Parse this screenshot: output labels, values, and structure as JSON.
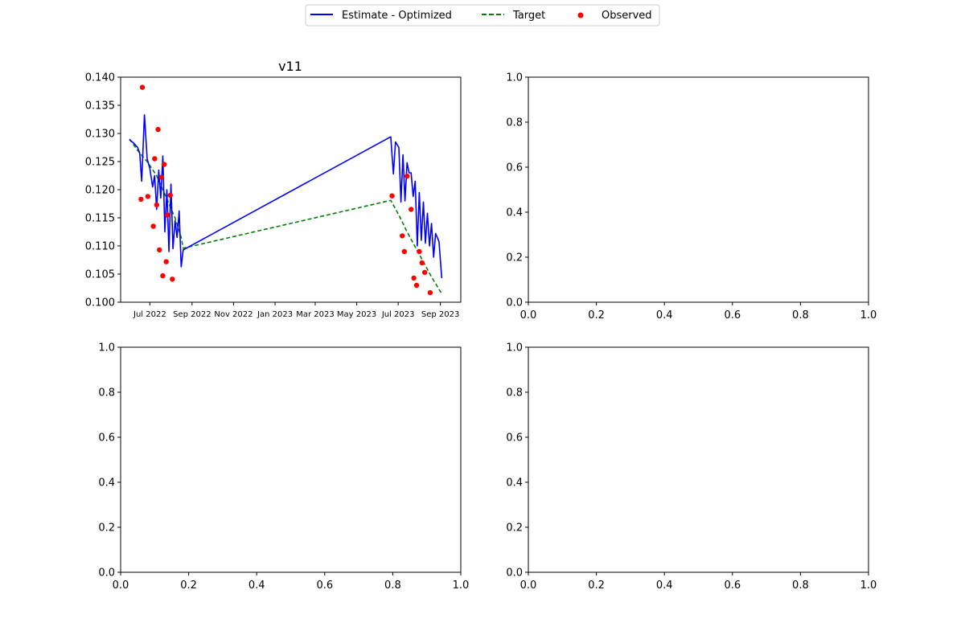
{
  "legend": {
    "placement": "top-center",
    "items": [
      {
        "label": "Estimate - Optimized",
        "color": "#0000ff",
        "style": "solid-line"
      },
      {
        "label": "Target",
        "color": "#008000",
        "style": "dashed-line"
      },
      {
        "label": "Observed",
        "color": "#ff0000",
        "style": "dot"
      }
    ]
  },
  "chart_data": [
    {
      "type": "line",
      "title": "v11",
      "xlabel": "",
      "ylabel": "",
      "x_axis": "date",
      "xlim": [
        "2022-05-19",
        "2023-10-01"
      ],
      "ylim": [
        0.1,
        0.14
      ],
      "xticks": [
        {
          "date": "2022-07-01",
          "label": "Jul 2022"
        },
        {
          "date": "2022-09-01",
          "label": "Sep 2022"
        },
        {
          "date": "2022-11-01",
          "label": "Nov 2022"
        },
        {
          "date": "2023-01-01",
          "label": "Jan 2023"
        },
        {
          "date": "2023-03-01",
          "label": "Mar 2023"
        },
        {
          "date": "2023-05-01",
          "label": "May 2023"
        },
        {
          "date": "2023-07-01",
          "label": "Jul 2023"
        },
        {
          "date": "2023-09-01",
          "label": "Sep 2023"
        }
      ],
      "yticks": [
        {
          "value": 0.1,
          "label": "0.100"
        },
        {
          "value": 0.105,
          "label": "0.105"
        },
        {
          "value": 0.11,
          "label": "0.110"
        },
        {
          "value": 0.115,
          "label": "0.115"
        },
        {
          "value": 0.12,
          "label": "0.120"
        },
        {
          "value": 0.125,
          "label": "0.125"
        },
        {
          "value": 0.13,
          "label": "0.130"
        },
        {
          "value": 0.135,
          "label": "0.135"
        },
        {
          "value": 0.14,
          "label": "0.140"
        }
      ],
      "series": [
        {
          "name": "Estimate - Optimized",
          "color": "#0000ff",
          "style": "solid",
          "points": [
            [
              "2022-06-01",
              0.1289
            ],
            [
              "2022-06-07",
              0.1283
            ],
            [
              "2022-06-13",
              0.1275
            ],
            [
              "2022-06-16",
              0.1265
            ],
            [
              "2022-06-19",
              0.1215
            ],
            [
              "2022-06-23",
              0.1333
            ],
            [
              "2022-06-27",
              0.1255
            ],
            [
              "2022-07-01",
              0.1237
            ],
            [
              "2022-07-05",
              0.1205
            ],
            [
              "2022-07-08",
              0.1225
            ],
            [
              "2022-07-11",
              0.1165
            ],
            [
              "2022-07-14",
              0.1235
            ],
            [
              "2022-07-17",
              0.1185
            ],
            [
              "2022-07-20",
              0.126
            ],
            [
              "2022-07-23",
              0.1125
            ],
            [
              "2022-07-26",
              0.12
            ],
            [
              "2022-07-29",
              0.109
            ],
            [
              "2022-08-01",
              0.121
            ],
            [
              "2022-08-04",
              0.1095
            ],
            [
              "2022-08-07",
              0.1145
            ],
            [
              "2022-08-10",
              0.1115
            ],
            [
              "2022-08-13",
              0.1162
            ],
            [
              "2022-08-16",
              0.1063
            ],
            [
              "2022-08-19",
              0.1093
            ],
            [
              "2023-06-20",
              0.1294
            ],
            [
              "2023-06-24",
              0.1228
            ],
            [
              "2023-06-27",
              0.1285
            ],
            [
              "2023-07-02",
              0.1275
            ],
            [
              "2023-07-05",
              0.1178
            ],
            [
              "2023-07-08",
              0.1262
            ],
            [
              "2023-07-11",
              0.118
            ],
            [
              "2023-07-14",
              0.1248
            ],
            [
              "2023-07-17",
              0.123
            ],
            [
              "2023-07-20",
              0.123
            ],
            [
              "2023-07-23",
              0.1188
            ],
            [
              "2023-07-26",
              0.1215
            ],
            [
              "2023-07-29",
              0.11
            ],
            [
              "2023-08-01",
              0.1195
            ],
            [
              "2023-08-04",
              0.111
            ],
            [
              "2023-08-07",
              0.1178
            ],
            [
              "2023-08-10",
              0.1105
            ],
            [
              "2023-08-13",
              0.1158
            ],
            [
              "2023-08-16",
              0.11
            ],
            [
              "2023-08-19",
              0.114
            ],
            [
              "2023-08-22",
              0.108
            ],
            [
              "2023-08-25",
              0.1122
            ],
            [
              "2023-08-30",
              0.1108
            ],
            [
              "2023-09-03",
              0.1043
            ]
          ]
        },
        {
          "name": "Target",
          "color": "#008000",
          "style": "dashed",
          "points": [
            [
              "2022-06-01",
              0.129
            ],
            [
              "2022-06-16",
              0.1265
            ],
            [
              "2022-06-27",
              0.125
            ],
            [
              "2022-07-11",
              0.1225
            ],
            [
              "2022-07-20",
              0.12
            ],
            [
              "2022-07-29",
              0.1175
            ],
            [
              "2022-08-07",
              0.115
            ],
            [
              "2022-08-16",
              0.1115
            ],
            [
              "2022-08-19",
              0.1096
            ],
            [
              "2023-06-20",
              0.1181
            ],
            [
              "2023-07-02",
              0.1155
            ],
            [
              "2023-07-14",
              0.1125
            ],
            [
              "2023-08-01",
              0.1085
            ],
            [
              "2023-08-19",
              0.1045
            ],
            [
              "2023-09-03",
              0.1015
            ]
          ]
        },
        {
          "name": "Observed",
          "color": "#ff0000",
          "style": "scatter",
          "points": [
            [
              "2022-06-18",
              0.1183
            ],
            [
              "2022-06-20",
              0.1382
            ],
            [
              "2022-06-28",
              0.1188
            ],
            [
              "2022-07-06",
              0.1135
            ],
            [
              "2022-07-08",
              0.1255
            ],
            [
              "2022-07-11",
              0.1173
            ],
            [
              "2022-07-13",
              0.1307
            ],
            [
              "2022-07-15",
              0.1093
            ],
            [
              "2022-07-18",
              0.1222
            ],
            [
              "2022-07-20",
              0.1047
            ],
            [
              "2022-07-22",
              0.1245
            ],
            [
              "2022-07-25",
              0.1072
            ],
            [
              "2022-07-27",
              0.1155
            ],
            [
              "2022-07-31",
              0.119
            ],
            [
              "2022-08-03",
              0.1041
            ],
            [
              "2023-06-22",
              0.1189
            ],
            [
              "2023-07-07",
              0.1118
            ],
            [
              "2023-07-10",
              0.109
            ],
            [
              "2023-07-14",
              0.1224
            ],
            [
              "2023-07-20",
              0.1165
            ],
            [
              "2023-07-24",
              0.1043
            ],
            [
              "2023-07-28",
              0.103
            ],
            [
              "2023-08-01",
              0.109
            ],
            [
              "2023-08-05",
              0.107
            ],
            [
              "2023-08-09",
              0.1053
            ],
            [
              "2023-08-17",
              0.1017
            ]
          ]
        }
      ]
    },
    {
      "type": "line",
      "title": "",
      "xlim": [
        0,
        1
      ],
      "ylim": [
        0,
        1
      ],
      "series": [],
      "xticks": [
        "0.0",
        "0.2",
        "0.4",
        "0.6",
        "0.8",
        "1.0"
      ],
      "yticks": [
        "0.0",
        "0.2",
        "0.4",
        "0.6",
        "0.8",
        "1.0"
      ]
    },
    {
      "type": "line",
      "title": "",
      "xlim": [
        0,
        1
      ],
      "ylim": [
        0,
        1
      ],
      "series": [],
      "xticks": [
        "0.0",
        "0.2",
        "0.4",
        "0.6",
        "0.8",
        "1.0"
      ],
      "yticks": [
        "0.0",
        "0.2",
        "0.4",
        "0.6",
        "0.8",
        "1.0"
      ]
    },
    {
      "type": "line",
      "title": "",
      "xlim": [
        0,
        1
      ],
      "ylim": [
        0,
        1
      ],
      "series": [],
      "xticks": [
        "0.0",
        "0.2",
        "0.4",
        "0.6",
        "0.8",
        "1.0"
      ],
      "yticks": [
        "0.0",
        "0.2",
        "0.4",
        "0.6",
        "0.8",
        "1.0"
      ]
    }
  ]
}
